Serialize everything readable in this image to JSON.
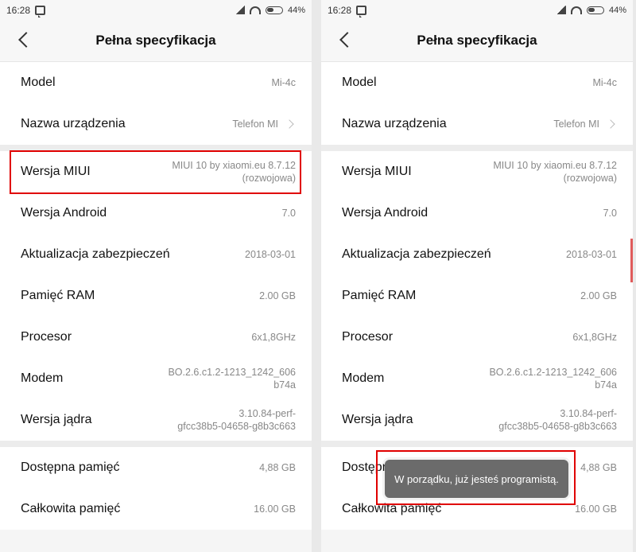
{
  "status": {
    "time": "16:28",
    "battery": "44%"
  },
  "header": {
    "title": "Pełna specyfikacja"
  },
  "rows": [
    {
      "label": "Model",
      "value": "Mi-4c"
    },
    {
      "label": "Nazwa urządzenia",
      "value": "Telefon MI"
    },
    {
      "label": "Wersja MIUI",
      "value1": "MIUI 10 by xiaomi.eu 8.7.12",
      "value2": "(rozwojowa)"
    },
    {
      "label": "Wersja Android",
      "value": "7.0"
    },
    {
      "label": "Aktualizacja zabezpieczeń",
      "value": "2018-03-01"
    },
    {
      "label": "Pamięć RAM",
      "value": "2.00 GB"
    },
    {
      "label": "Procesor",
      "value": "6x1,8GHz"
    },
    {
      "label": "Modem",
      "value1": "BO.2.6.c1.2-1213_1242_606",
      "value2": "b74a"
    },
    {
      "label": "Wersja jądra",
      "value1": "3.10.84-perf-",
      "value2": "gfcc38b5-04658-g8b3c663"
    },
    {
      "label": "Dostępna pamięć",
      "value": "4,88 GB"
    },
    {
      "label": "Całkowita pamięć",
      "value": "16.00 GB"
    }
  ],
  "toast": {
    "text": "W porządku, już jesteś programistą."
  },
  "colors": {
    "highlight": "#e00000",
    "toast_bg": "#6b6b6b"
  }
}
